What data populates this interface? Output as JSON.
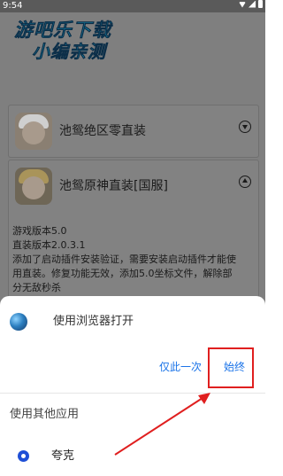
{
  "status_bar": {
    "time": "9:54"
  },
  "watermark": {
    "line1": "游吧乐下载",
    "line2": "小编亲测"
  },
  "cards": [
    {
      "title": "池鸳绝区零直装",
      "chevron": "chevron-down-circle-icon"
    },
    {
      "title": "池鸳原神直装[国服]",
      "chevron": "chevron-up-circle-icon",
      "lines": [
        "游戏版本5.0",
        "直装版本2.0.3.1",
        "添加了启动插件安装验证，需要安装启动插件才能使",
        "用直装。修复功能无效，添加5.0坐标文件，解除部",
        "分无敌秒杀"
      ]
    }
  ],
  "sheet": {
    "title": "使用浏览器打开",
    "just_once_label": "仅此一次",
    "always_label": "始终",
    "other_apps_label": "使用其他应用",
    "apps": [
      {
        "name": "夸克",
        "icon": "quark-icon"
      }
    ]
  },
  "colors": {
    "accent": "#1a73e8",
    "highlight": "#e01f1f",
    "overlay": "#7f7f7f"
  }
}
